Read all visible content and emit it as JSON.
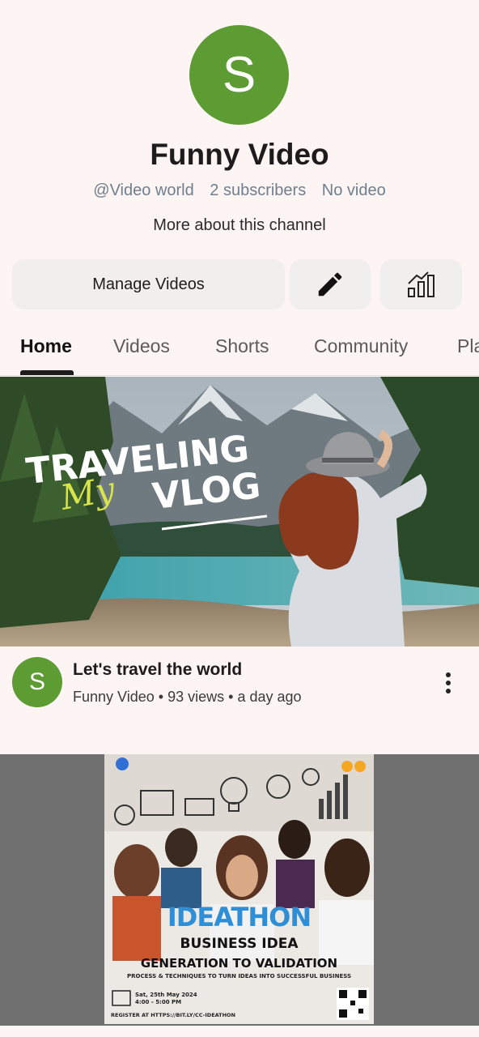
{
  "channel": {
    "avatar_letter": "S",
    "avatar_color": "#5d9b33",
    "name": "Funny Video",
    "handle": "@Video world",
    "subscribers": "2 subscribers",
    "video_count": "No video",
    "more_about": "More about this channel"
  },
  "actions": {
    "manage_label": "Manage Videos",
    "edit_icon": "pencil-icon",
    "stats_icon": "analytics-icon"
  },
  "tabs": [
    {
      "label": "Home",
      "active": true
    },
    {
      "label": "Videos",
      "active": false
    },
    {
      "label": "Shorts",
      "active": false
    },
    {
      "label": "Community",
      "active": false
    },
    {
      "label": "Playlists",
      "active": false
    }
  ],
  "videos": [
    {
      "thumbnail_text_1": "TRAVELING",
      "thumbnail_text_2": "VLOG",
      "thumbnail_script": "My",
      "title": "Let's travel the world",
      "channel": "Funny Video",
      "views": "93 views",
      "age": "a day ago"
    },
    {
      "poster_title": "IDEATHON",
      "poster_subtitle": "BUSINESS IDEA",
      "poster_subtitle2": "GENERATION TO VALIDATION",
      "poster_tagline": "PROCESS & TECHNIQUES TO TURN IDEAS INTO SUCCESSFUL BUSINESS",
      "poster_date": "Sat, 25th May 2024",
      "poster_time": "4:00 - 5:00 PM",
      "poster_register": "REGISTER AT HTTPS://BIT.LY/CC-IDEATHON"
    }
  ]
}
